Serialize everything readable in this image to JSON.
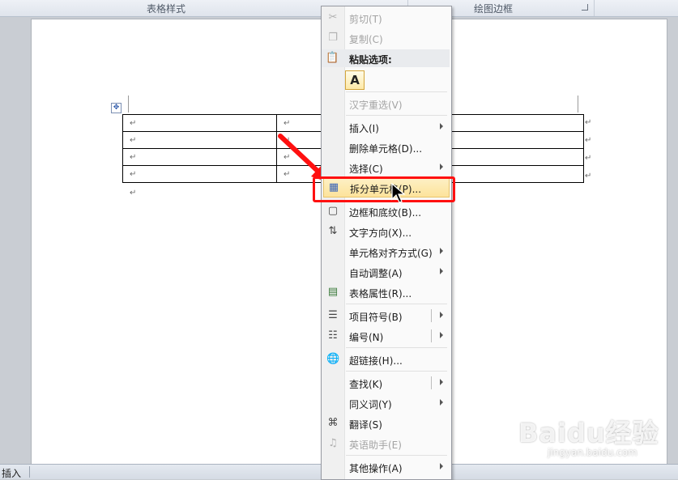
{
  "ribbon": {
    "groups": [
      "表格样式",
      "绘图边框"
    ]
  },
  "status_bar": {
    "mode": "插入"
  },
  "document": {
    "table_rows": 4,
    "cells": [
      [
        "↵",
        "↵",
        "↵"
      ],
      [
        "↵",
        "↵",
        "↵"
      ],
      [
        "↵",
        "↵",
        "↵"
      ],
      [
        "↵",
        "↵",
        "↵"
      ]
    ],
    "row_end_mark": "↵",
    "after_table_mark": "↵"
  },
  "context_menu": {
    "items": [
      {
        "label": "剪切(T)",
        "icon": "scissors-icon",
        "disabled": true
      },
      {
        "label": "复制(C)",
        "icon": "copy-icon",
        "disabled": true
      },
      {
        "label": "粘贴选项:",
        "icon": "paste-icon",
        "header": true
      },
      {
        "label": "A",
        "icon": "keep-text-only-icon"
      },
      {
        "label": "汉字重选(V)",
        "disabled": true
      },
      {
        "label": "插入(I)",
        "submenu": true
      },
      {
        "label": "删除单元格(D)..."
      },
      {
        "label": "选择(C)",
        "submenu": true
      },
      {
        "label": "拆分单元格(P)...",
        "icon": "split-cells-icon",
        "highlighted": true
      },
      {
        "label": "边框和底纹(B)...",
        "icon": "borders-icon"
      },
      {
        "label": "文字方向(X)...",
        "icon": "text-direction-icon"
      },
      {
        "label": "单元格对齐方式(G)",
        "submenu": true
      },
      {
        "label": "自动调整(A)",
        "submenu": true
      },
      {
        "label": "表格属性(R)...",
        "icon": "table-properties-icon"
      },
      {
        "label": "项目符号(B)",
        "icon": "bullets-icon",
        "split_submenu": true
      },
      {
        "label": "编号(N)",
        "icon": "numbering-icon",
        "split_submenu": true
      },
      {
        "label": "超链接(H)...",
        "icon": "hyperlink-icon"
      },
      {
        "label": "查找(K)",
        "split_submenu": true
      },
      {
        "label": "同义词(Y)",
        "submenu": true
      },
      {
        "label": "翻译(S)",
        "icon": "translate-icon"
      },
      {
        "label": "英语助手(E)",
        "icon": "english-assistant-icon",
        "disabled": true
      },
      {
        "label": "其他操作(A)",
        "submenu": true
      }
    ]
  },
  "watermark": {
    "brand": "Baidu经验",
    "url": "jingyan.baidu.com"
  },
  "colors": {
    "highlight_box": "#ff1010",
    "menu_highlight": "#fde39b"
  }
}
